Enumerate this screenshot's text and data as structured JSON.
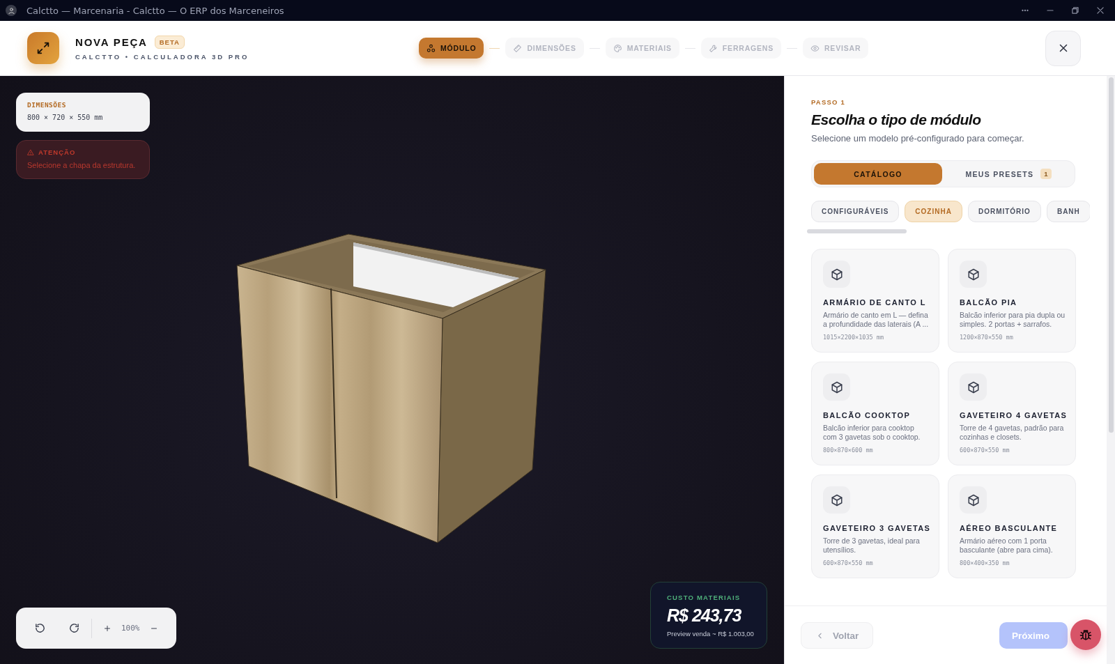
{
  "window": {
    "title": "Calctto — Marcenaria - Calctto — O ERP dos Marceneiros"
  },
  "header": {
    "title": "NOVA PEÇA",
    "badge": "BETA",
    "subtitle": "CALCTTO • CALCULADORA 3D PRO"
  },
  "steps": [
    {
      "label": "MÓDULO",
      "kind": "module",
      "selected": true
    },
    {
      "label": "DIMENSÕES",
      "kind": "ruler",
      "selected": false
    },
    {
      "label": "MATERIAIS",
      "kind": "palette",
      "selected": false
    },
    {
      "label": "FERRAGENS",
      "kind": "wrench",
      "selected": false
    },
    {
      "label": "REVISAR",
      "kind": "eye",
      "selected": false
    }
  ],
  "viewport": {
    "dimensions": {
      "label": "DIMENSÕES",
      "value": "800 × 720 × 550 mm"
    },
    "alert": {
      "title": "ATENÇÃO",
      "message": "Selecione a chapa da estrutura."
    },
    "zoom": "100%",
    "cost": {
      "label": "CUSTO MATERIAIS",
      "value": "R$ 243,73",
      "note": "Preview venda ~ R$ 1.003,00"
    }
  },
  "panel": {
    "step": "PASSO 1",
    "title": "Escolha o tipo de módulo",
    "subtitle": "Selecione um modelo pré-configurado para começar.",
    "tabs": [
      {
        "label": "CATÁLOGO",
        "selected": true
      },
      {
        "label": "MEUS PRESETS",
        "badge": "1",
        "selected": false
      }
    ],
    "categories": [
      {
        "label": "CONFIGURÁVEIS",
        "selected": false
      },
      {
        "label": "COZINHA",
        "selected": true
      },
      {
        "label": "DORMITÓRIO",
        "selected": false
      },
      {
        "label": "BANH",
        "selected": false
      }
    ],
    "modules": [
      {
        "name": "ARMÁRIO DE CANTO L",
        "description": "Armário de canto em L — defina a profundidade das laterais (A ...",
        "size": "1015×2200×1035 mm"
      },
      {
        "name": "BALCÃO PIA",
        "description": "Balcão inferior para pia dupla ou simples. 2 portas + sarrafos.",
        "size": "1200×870×550 mm"
      },
      {
        "name": "BALCÃO COOKTOP",
        "description": "Balcão inferior para cooktop com 3 gavetas sob o cooktop.",
        "size": "800×870×600 mm"
      },
      {
        "name": "GAVETEIRO 4 GAVETAS",
        "description": "Torre de 4 gavetas, padrão para cozinhas e closets.",
        "size": "600×870×550 mm"
      },
      {
        "name": "GAVETEIRO 3 GAVETAS",
        "description": "Torre de 3 gavetas, ideal para utensílios.",
        "size": "600×870×550 mm"
      },
      {
        "name": "AÉREO BASCULANTE",
        "description": "Armário aéreo com 1 porta basculante (abre para cima).",
        "size": "800×400×350 mm"
      }
    ],
    "back": "Voltar",
    "next": "Próximo"
  }
}
